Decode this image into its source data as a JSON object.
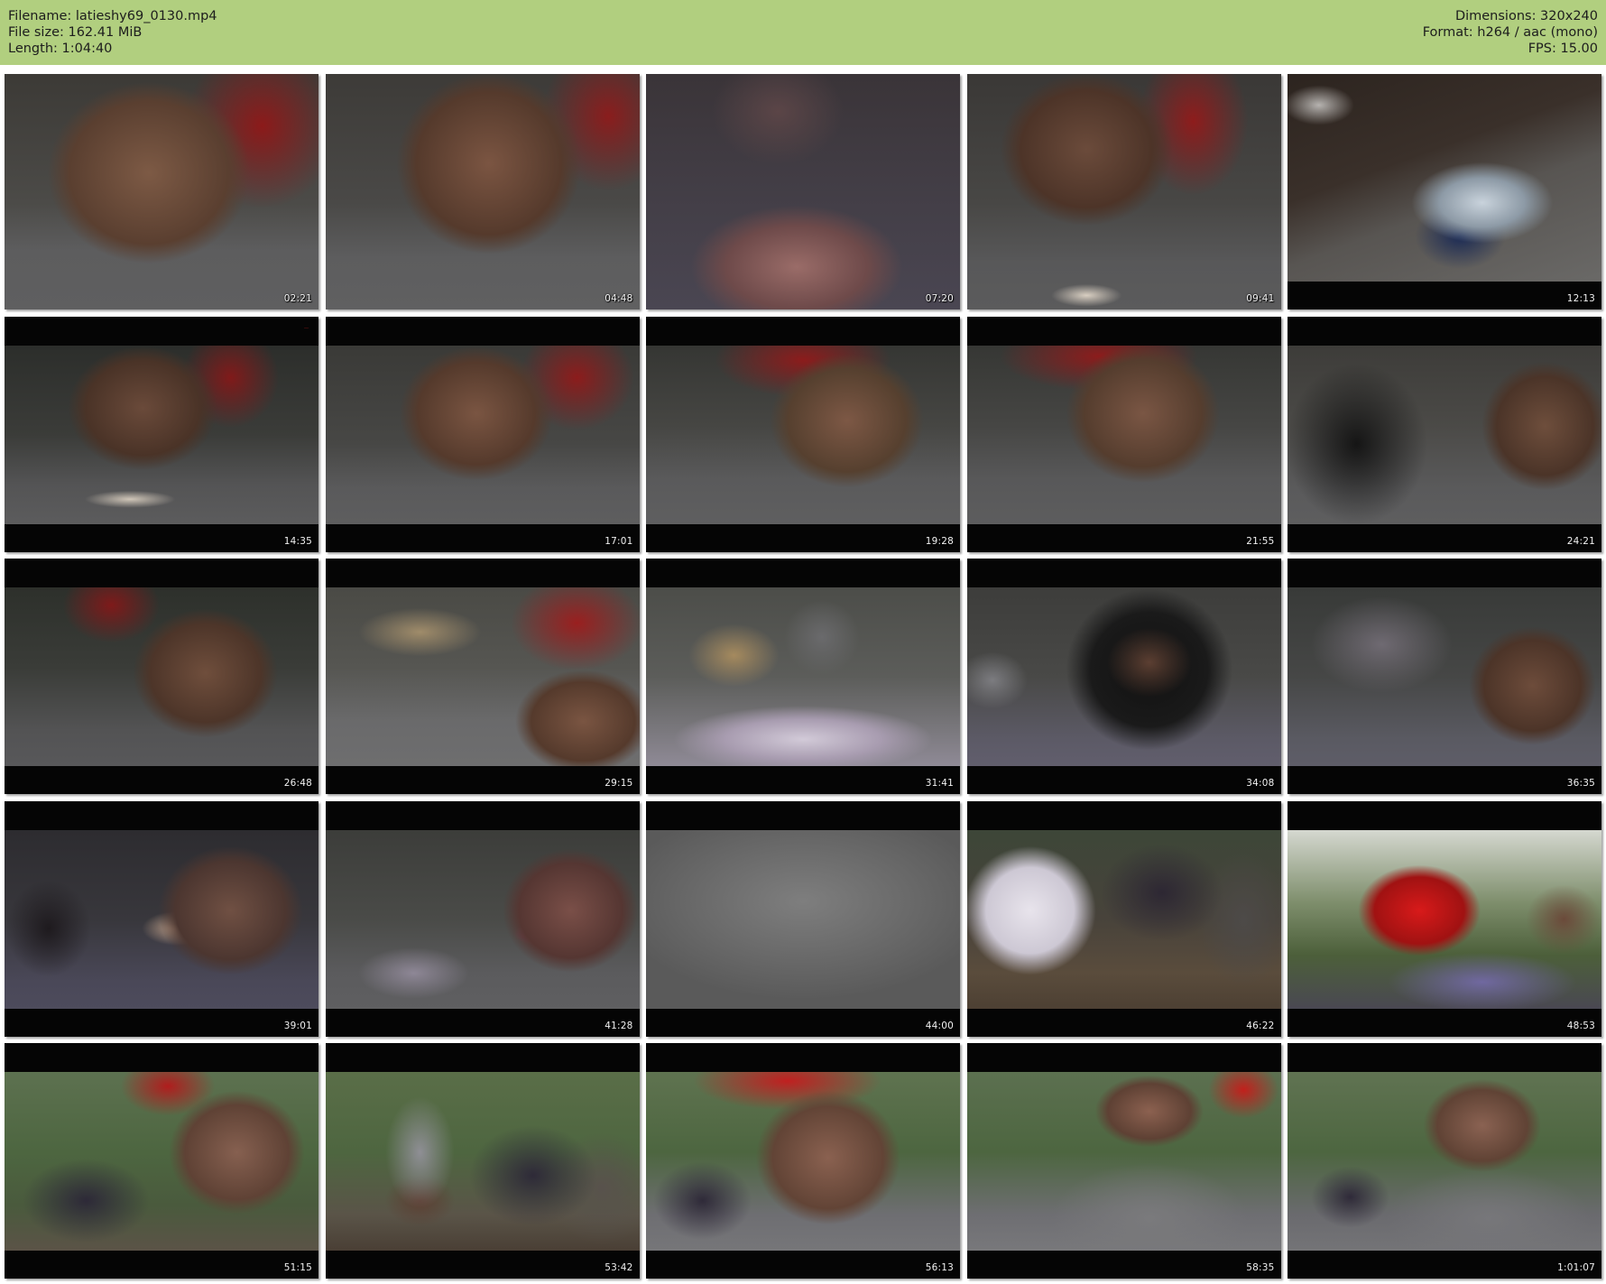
{
  "header": {
    "filename": "Filename: latieshy69_0130.mp4",
    "filesize": "File size: 162.41 MiB",
    "length": "Length: 1:04:40",
    "dimensions": "Dimensions: 320x240",
    "format": "Format: h264 / aac (mono)",
    "fps": "FPS: 15.00",
    "background_color": "#b1cf7f"
  },
  "thumbnails": [
    {
      "time": "02:21"
    },
    {
      "time": "04:48"
    },
    {
      "time": "07:20"
    },
    {
      "time": "09:41"
    },
    {
      "time": "12:13"
    },
    {
      "time": "14:35"
    },
    {
      "time": "17:01"
    },
    {
      "time": "19:28"
    },
    {
      "time": "21:55"
    },
    {
      "time": "24:21"
    },
    {
      "time": "26:48"
    },
    {
      "time": "29:15"
    },
    {
      "time": "31:41"
    },
    {
      "time": "34:08"
    },
    {
      "time": "36:35"
    },
    {
      "time": "39:01"
    },
    {
      "time": "41:28"
    },
    {
      "time": "44:00"
    },
    {
      "time": "46:22"
    },
    {
      "time": "48:53"
    },
    {
      "time": "51:15"
    },
    {
      "time": "53:42"
    },
    {
      "time": "56:13"
    },
    {
      "time": "58:35"
    },
    {
      "time": "1:01:07"
    }
  ]
}
